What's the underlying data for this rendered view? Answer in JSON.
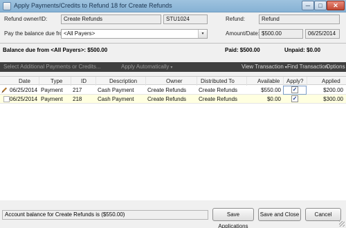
{
  "window": {
    "title": "Apply Payments/Credits to Refund 18 for Create Refunds",
    "min_glyph": "─",
    "max_glyph": "□",
    "close_glyph": "✕"
  },
  "form": {
    "owner_label": "Refund owner/ID:",
    "owner_value": "Create Refunds",
    "owner_id": "STU1024",
    "pay_label": "Pay the balance due from:",
    "pay_value": "<All Payers>",
    "refund_label": "Refund:",
    "refund_value": "Refund",
    "amount_label": "Amount/Date:",
    "amount_value": "$500.00",
    "date_value": "06/25/2014"
  },
  "balance": {
    "due_text": "Balance due from <All Payers>: $500.00",
    "paid_text": "Paid: $500.00",
    "unpaid_text": "Unpaid: $0.00"
  },
  "toolbar": {
    "select_additional": "Select Additional Payments or Credits...",
    "apply_automatically": "Apply Automatically",
    "view_transaction": "View Transaction",
    "find_transaction": "Find Transaction",
    "options": "Options",
    "caret": "▾"
  },
  "grid": {
    "columns": [
      "Date",
      "Type",
      "ID",
      "Description",
      "Owner",
      "Distributed To",
      "Available",
      "Apply?",
      "Applied"
    ],
    "rows": [
      {
        "date": "06/25/2014",
        "type": "Payment",
        "id": "217",
        "description": "Cash Payment",
        "owner": "Create Refunds",
        "distributed_to": "Create Refunds",
        "available": "$550.00",
        "apply": true,
        "applied": "$200.00"
      },
      {
        "date": "06/25/2014",
        "type": "Payment",
        "id": "218",
        "description": "Cash Payment",
        "owner": "Create Refunds",
        "distributed_to": "Create Refunds",
        "available": "$0.00",
        "apply": true,
        "applied": "$300.00"
      }
    ]
  },
  "footer": {
    "status": "Account balance for Create Refunds is ($550.00)",
    "save_applications": "Save Applications",
    "save_and_close": "Save and Close",
    "cancel": "Cancel"
  },
  "colors": {
    "titlebar": "#9ec3df",
    "toolbar": "#3f3f3f",
    "row_highlight": "#ffffe0"
  },
  "icons": {
    "pencil": "edit-pencil-icon",
    "check": "checkmark-icon"
  }
}
